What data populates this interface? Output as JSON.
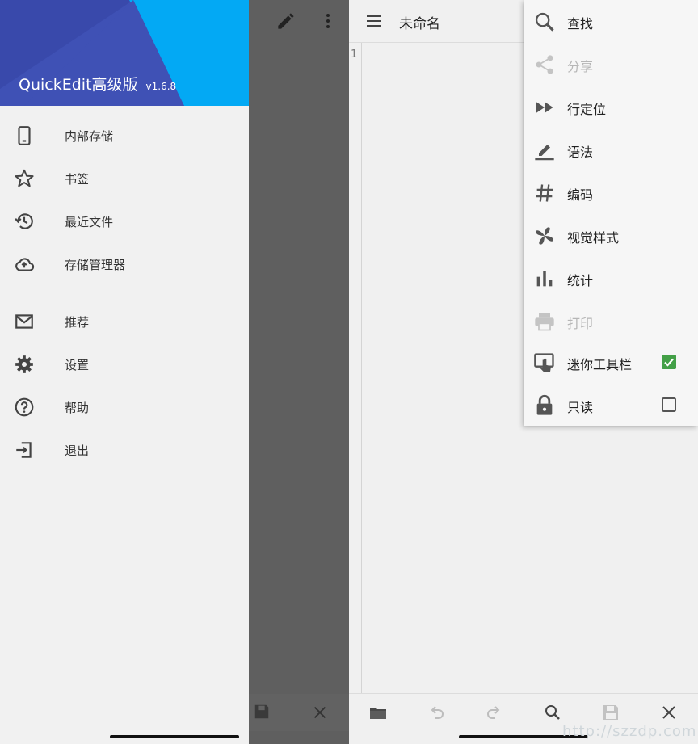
{
  "drawer": {
    "app_name": "QuickEdit高级版",
    "version": "v1.6.8",
    "items_top": [
      {
        "label": "内部存储",
        "icon": "phone-icon"
      },
      {
        "label": "书签",
        "icon": "star-icon"
      },
      {
        "label": "最近文件",
        "icon": "history-icon"
      },
      {
        "label": "存储管理器",
        "icon": "cloud-upload-icon"
      }
    ],
    "items_bottom": [
      {
        "label": "推荐",
        "icon": "mail-icon"
      },
      {
        "label": "设置",
        "icon": "gear-icon"
      },
      {
        "label": "帮助",
        "icon": "help-icon"
      },
      {
        "label": "退出",
        "icon": "exit-icon"
      }
    ]
  },
  "editor": {
    "title": "未命名",
    "line_number": "1"
  },
  "menu": {
    "items": [
      {
        "label": "查找",
        "icon": "search-icon",
        "enabled": true
      },
      {
        "label": "分享",
        "icon": "share-icon",
        "enabled": false
      },
      {
        "label": "行定位",
        "icon": "fast-forward-icon",
        "enabled": true
      },
      {
        "label": "语法",
        "icon": "highlighter-icon",
        "enabled": true
      },
      {
        "label": "编码",
        "icon": "hash-icon",
        "enabled": true
      },
      {
        "label": "视觉样式",
        "icon": "pinwheel-icon",
        "enabled": true
      },
      {
        "label": "统计",
        "icon": "bar-chart-icon",
        "enabled": true
      },
      {
        "label": "打印",
        "icon": "printer-icon",
        "enabled": false
      },
      {
        "label": "迷你工具栏",
        "icon": "touch-app-icon",
        "enabled": true,
        "checked": true
      },
      {
        "label": "只读",
        "icon": "lock-icon",
        "enabled": true,
        "checked": false
      }
    ]
  },
  "watermark": "http://szzdp.com",
  "colors": {
    "drawer_header": "#3f51b5",
    "drawer_accent": "#03a9f4",
    "checkbox_checked": "#43a047",
    "scrim": "#5f5f5f"
  }
}
